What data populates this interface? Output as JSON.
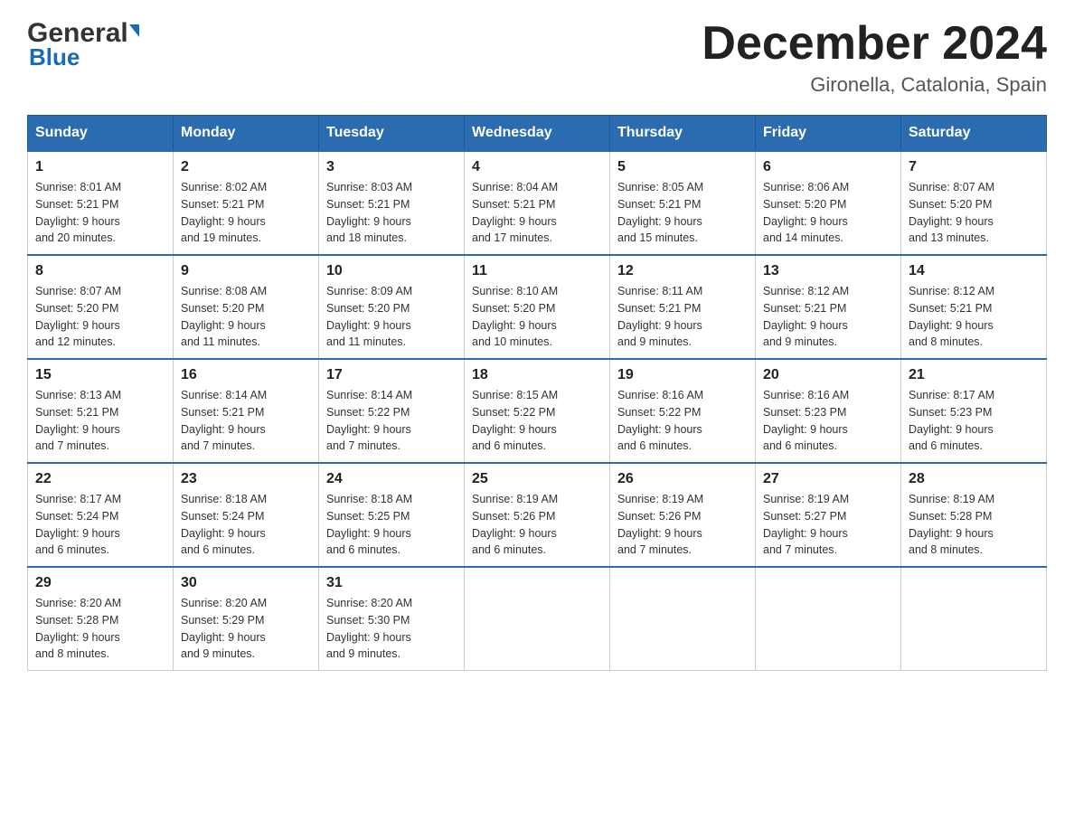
{
  "header": {
    "logo_general": "General",
    "logo_blue": "Blue",
    "month_title": "December 2024",
    "location": "Gironella, Catalonia, Spain"
  },
  "weekdays": [
    "Sunday",
    "Monday",
    "Tuesday",
    "Wednesday",
    "Thursday",
    "Friday",
    "Saturday"
  ],
  "weeks": [
    [
      {
        "day": "1",
        "sunrise": "8:01 AM",
        "sunset": "5:21 PM",
        "daylight": "9 hours and 20 minutes."
      },
      {
        "day": "2",
        "sunrise": "8:02 AM",
        "sunset": "5:21 PM",
        "daylight": "9 hours and 19 minutes."
      },
      {
        "day": "3",
        "sunrise": "8:03 AM",
        "sunset": "5:21 PM",
        "daylight": "9 hours and 18 minutes."
      },
      {
        "day": "4",
        "sunrise": "8:04 AM",
        "sunset": "5:21 PM",
        "daylight": "9 hours and 17 minutes."
      },
      {
        "day": "5",
        "sunrise": "8:05 AM",
        "sunset": "5:21 PM",
        "daylight": "9 hours and 15 minutes."
      },
      {
        "day": "6",
        "sunrise": "8:06 AM",
        "sunset": "5:20 PM",
        "daylight": "9 hours and 14 minutes."
      },
      {
        "day": "7",
        "sunrise": "8:07 AM",
        "sunset": "5:20 PM",
        "daylight": "9 hours and 13 minutes."
      }
    ],
    [
      {
        "day": "8",
        "sunrise": "8:07 AM",
        "sunset": "5:20 PM",
        "daylight": "9 hours and 12 minutes."
      },
      {
        "day": "9",
        "sunrise": "8:08 AM",
        "sunset": "5:20 PM",
        "daylight": "9 hours and 11 minutes."
      },
      {
        "day": "10",
        "sunrise": "8:09 AM",
        "sunset": "5:20 PM",
        "daylight": "9 hours and 11 minutes."
      },
      {
        "day": "11",
        "sunrise": "8:10 AM",
        "sunset": "5:20 PM",
        "daylight": "9 hours and 10 minutes."
      },
      {
        "day": "12",
        "sunrise": "8:11 AM",
        "sunset": "5:21 PM",
        "daylight": "9 hours and 9 minutes."
      },
      {
        "day": "13",
        "sunrise": "8:12 AM",
        "sunset": "5:21 PM",
        "daylight": "9 hours and 9 minutes."
      },
      {
        "day": "14",
        "sunrise": "8:12 AM",
        "sunset": "5:21 PM",
        "daylight": "9 hours and 8 minutes."
      }
    ],
    [
      {
        "day": "15",
        "sunrise": "8:13 AM",
        "sunset": "5:21 PM",
        "daylight": "9 hours and 7 minutes."
      },
      {
        "day": "16",
        "sunrise": "8:14 AM",
        "sunset": "5:21 PM",
        "daylight": "9 hours and 7 minutes."
      },
      {
        "day": "17",
        "sunrise": "8:14 AM",
        "sunset": "5:22 PM",
        "daylight": "9 hours and 7 minutes."
      },
      {
        "day": "18",
        "sunrise": "8:15 AM",
        "sunset": "5:22 PM",
        "daylight": "9 hours and 6 minutes."
      },
      {
        "day": "19",
        "sunrise": "8:16 AM",
        "sunset": "5:22 PM",
        "daylight": "9 hours and 6 minutes."
      },
      {
        "day": "20",
        "sunrise": "8:16 AM",
        "sunset": "5:23 PM",
        "daylight": "9 hours and 6 minutes."
      },
      {
        "day": "21",
        "sunrise": "8:17 AM",
        "sunset": "5:23 PM",
        "daylight": "9 hours and 6 minutes."
      }
    ],
    [
      {
        "day": "22",
        "sunrise": "8:17 AM",
        "sunset": "5:24 PM",
        "daylight": "9 hours and 6 minutes."
      },
      {
        "day": "23",
        "sunrise": "8:18 AM",
        "sunset": "5:24 PM",
        "daylight": "9 hours and 6 minutes."
      },
      {
        "day": "24",
        "sunrise": "8:18 AM",
        "sunset": "5:25 PM",
        "daylight": "9 hours and 6 minutes."
      },
      {
        "day": "25",
        "sunrise": "8:19 AM",
        "sunset": "5:26 PM",
        "daylight": "9 hours and 6 minutes."
      },
      {
        "day": "26",
        "sunrise": "8:19 AM",
        "sunset": "5:26 PM",
        "daylight": "9 hours and 7 minutes."
      },
      {
        "day": "27",
        "sunrise": "8:19 AM",
        "sunset": "5:27 PM",
        "daylight": "9 hours and 7 minutes."
      },
      {
        "day": "28",
        "sunrise": "8:19 AM",
        "sunset": "5:28 PM",
        "daylight": "9 hours and 8 minutes."
      }
    ],
    [
      {
        "day": "29",
        "sunrise": "8:20 AM",
        "sunset": "5:28 PM",
        "daylight": "9 hours and 8 minutes."
      },
      {
        "day": "30",
        "sunrise": "8:20 AM",
        "sunset": "5:29 PM",
        "daylight": "9 hours and 9 minutes."
      },
      {
        "day": "31",
        "sunrise": "8:20 AM",
        "sunset": "5:30 PM",
        "daylight": "9 hours and 9 minutes."
      },
      null,
      null,
      null,
      null
    ]
  ]
}
